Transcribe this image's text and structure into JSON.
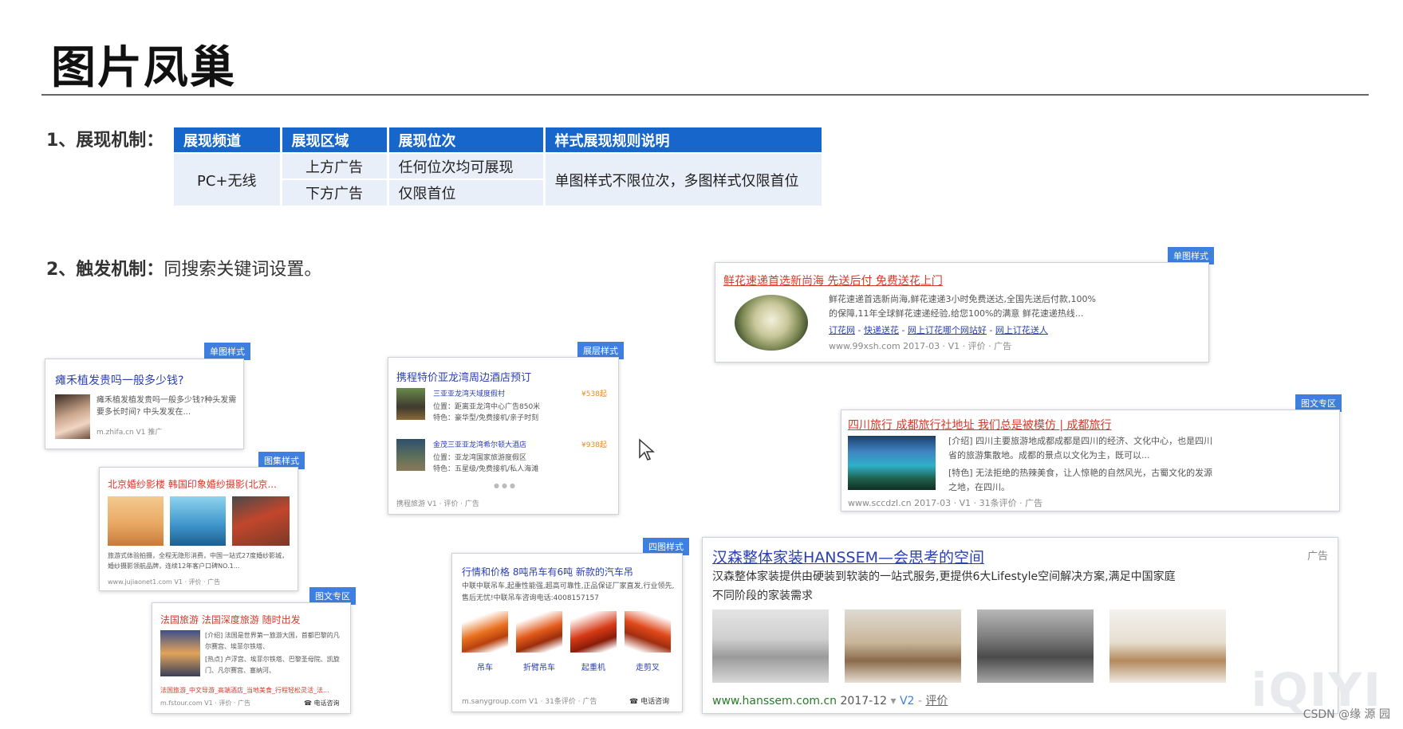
{
  "title": "图片凤巢",
  "section1": {
    "label": "1、展现机制："
  },
  "table": {
    "headers": [
      "展现频道",
      "展现区域",
      "展现位次",
      "样式展现规则说明"
    ],
    "channel": "PC+无线",
    "rows": [
      {
        "area": "上方广告",
        "position": "任何位次均可展现"
      },
      {
        "area": "下方广告",
        "position": "仅限首位"
      }
    ],
    "rule": "单图样式不限位次，多图样式仅限首位"
  },
  "section2": {
    "label": "2、触发机制：",
    "text": "同搜索关键词设置。"
  },
  "ad_single_small": {
    "tag": "单图样式",
    "title": "瘫禾植发贵吗一般多少钱?",
    "desc": "瘫禾植发植发贵吗一般多少钱?种头发需要多长时间? 中头发发在...",
    "footer": "m.zhifa.cn  V1  推广"
  },
  "ad_multi_photo": {
    "tag": "图集样式",
    "title": "北京婚纱影楼 韩国印象婚纱摄影(北京...",
    "desc": "旅游式体验拍摄，全程无隐形消费，中国一站式27度婚纱影城，婚纱摄影领航品牌，连续12年客户口碑NO.1...",
    "footer": "www.jujiaonet1.com  V1 · 评价 · 广告"
  },
  "ad_news_small": {
    "tag": "图文专区",
    "title": "法国旅游 法国深度旅游 随时出发",
    "line1": "[介绍] 法国是世界第一旅游大国，首都巴黎的凡尔赛宫、埃菲尔铁塔、",
    "line2": "[热点] 卢浮宫、埃菲尔铁塔、巴黎圣母院、凯旋门、凡尔赛宫、塞纳河、",
    "links": "法国旅游_中文导游_高端酒店_当地美食_行程轻松灵活_法...",
    "footer": "m.fstour.com  V1 · 评价 · 广告",
    "phone": "电话咨询"
  },
  "ad_list": {
    "tag": "展层样式",
    "title": "携程特价亚龙湾周边酒店预订",
    "items": [
      {
        "name": "三亚亚龙湾天域度假村",
        "price": "¥538起",
        "loc": "位置：距离亚龙湾中心广告850米",
        "feat": "特色：豪华型/免费接机/亲子时刻"
      },
      {
        "name": "金茂三亚亚龙湾希尔顿大酒店",
        "price": "¥938起",
        "loc": "位置：亚龙湾国家旅游度假区",
        "feat": "特色：五星级/免费接机/私人海滩"
      }
    ],
    "footer": "携程旅游  V1 · 评价 · 广告"
  },
  "ad_four_img": {
    "tag": "四图样式",
    "title": "行情和价格 8吨吊车有6吨 新款的汽车吊",
    "desc": "中联中联吊车,起重性能强,超高可靠性,正品保证厂家直发,行业领先,售后无忧!中联吊车咨询电话:4008157157",
    "captions": [
      "吊车",
      "折臂吊车",
      "起重机",
      "走剪叉"
    ],
    "footer": "m.sanygroup.com  V1 · 31条评价 · 广告",
    "phone": "电话咨询"
  },
  "ad_single_large": {
    "tag": "单图样式",
    "title": "鲜花速递首选新尚海 先送后付 免费送花上门",
    "desc1": "鲜花速递首选新尚海,鲜花速递3小时免费送达,全国先送后付款,100%",
    "desc2": "的保障,11年全球鲜花速递经验,给您100%的满意 鲜花速递热线...",
    "links": [
      "订花网",
      "快递送花",
      "网上订花哪个网站好",
      "网上订花送人"
    ],
    "footer": "www.99xsh.com  2017-03  ·  V1 · 评价 · 广告"
  },
  "ad_news_large": {
    "tag": "图文专区",
    "title": "四川旅行 成都旅行社地址 我们总是被模仿 | 成都旅行",
    "line1": "[介绍] 四川主要旅游地成都成都是四川的经济、文化中心，也是四川",
    "line2": "省的旅游集散地。成都的景点以文化为主，既可以...",
    "line3": "[特色] 无法拒绝的热辣美食，让人惊艳的自然风光，古蜀文化的发源",
    "line4": "之地，在四川。",
    "footer": "www.sccdzl.cn  2017-03  ·  V1 · 31条评价 · 广告"
  },
  "ad_hanssem": {
    "title": "汉森整体家装HANSSEM—会思考的空间",
    "ad_label": "广告",
    "desc1": "汉森整体家装提供由硬装到软装的一站式服务,更提供6大Lifestyle空间解决方案,满足中国家庭",
    "desc2": "不同阶段的家装需求",
    "footer_url": "www.hanssem.com.cn",
    "footer_date": "2017-12",
    "footer_v": "V2",
    "footer_review": "评价"
  },
  "watermark": "iQIYI",
  "credit": "CSDN @缘  源  园",
  "colors": {
    "header_blue": "#1666cc",
    "cell_bg": "#e9eff8",
    "tag_blue": "#3f7fe0",
    "link_blue": "#2a3fb0",
    "keyword_red": "#d23a2a"
  }
}
